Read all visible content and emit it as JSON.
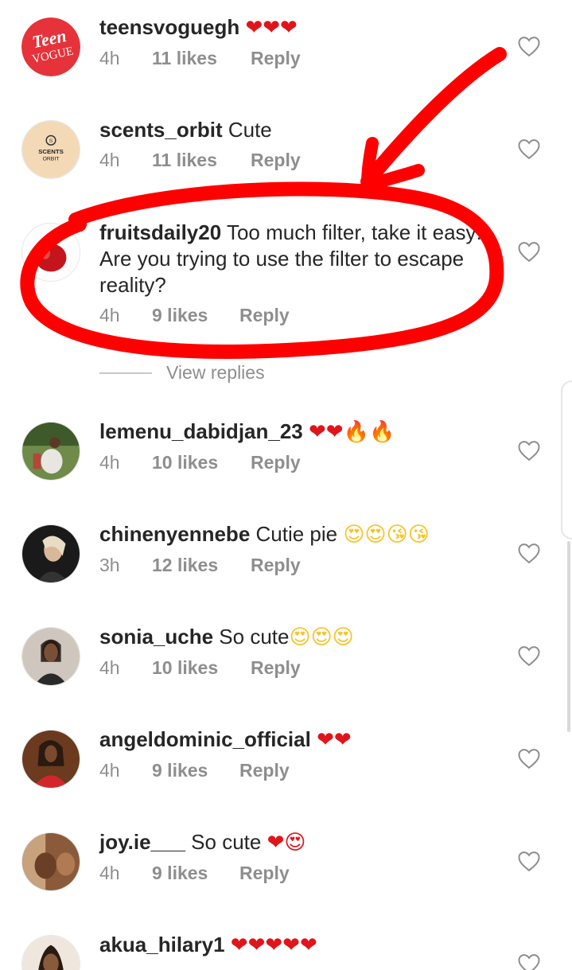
{
  "comments": [
    {
      "username": "teensvoguegh",
      "text": "",
      "emoji": "❤❤❤",
      "time": "4h",
      "likes": "11 likes",
      "reply": "Reply"
    },
    {
      "username": "scents_orbit",
      "text": "Cute",
      "emoji": "",
      "time": "4h",
      "likes": "11 likes",
      "reply": "Reply"
    },
    {
      "username": "fruitsdaily20",
      "text": "Too much filter, take it easy! Are you trying to use the filter to escape reality?",
      "emoji": "",
      "time": "4h",
      "likes": "9 likes",
      "reply": "Reply"
    },
    {
      "username": "lemenu_dabidjan_23",
      "text": "",
      "emoji": "❤❤🔥🔥",
      "time": "4h",
      "likes": "10 likes",
      "reply": "Reply"
    },
    {
      "username": "chinenyennebe",
      "text": "Cutie pie",
      "emoji": "😍😍😘😘",
      "time": "3h",
      "likes": "12 likes",
      "reply": "Reply"
    },
    {
      "username": "sonia_uche",
      "text": "So cute",
      "emoji": "😍😍😍",
      "time": "4h",
      "likes": "10 likes",
      "reply": "Reply"
    },
    {
      "username": "angeldominic_official",
      "text": "",
      "emoji": "❤❤",
      "time": "4h",
      "likes": "9 likes",
      "reply": "Reply"
    },
    {
      "username": "joy.ie___",
      "text": "So cute",
      "emoji": "❤😍",
      "time": "4h",
      "likes": "9 likes",
      "reply": "Reply"
    },
    {
      "username": "akua_hilary1",
      "text": "",
      "emoji": "❤❤❤❤❤",
      "time": "",
      "likes": "",
      "reply": ""
    }
  ],
  "view_replies": "View replies",
  "avatars": {
    "teen_vogue_logo": "Teen VOGUE",
    "scents_orbit_logo": "SCENTS ORBIT"
  },
  "colors": {
    "annotation_red": "#ff0000",
    "heart_red": "#e0151b",
    "meta_gray": "#8e8e8e"
  },
  "icons": {
    "like": "heart-outline-icon"
  }
}
